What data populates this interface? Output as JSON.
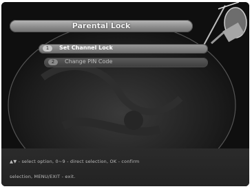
{
  "menu": {
    "title": "Parental Lock",
    "items": [
      {
        "number": "1",
        "label": "Set Channel Lock",
        "selected": true
      },
      {
        "number": "2",
        "label": "Change PIN Code",
        "selected": false
      }
    ]
  },
  "help": {
    "line1": "▲▼ - select option, 0~9 - direct selection, OK - confirm",
    "line2": "selection, MENU/EXIT - exit."
  },
  "colors": {
    "screen_bg": "#0f0f0f",
    "title_bar": "#9a9a9a",
    "selected_item": "#858585",
    "normal_item": "#4a4a4a",
    "help_bar": "#262626"
  },
  "icons": [
    "satellite-dish-icon",
    "earth-backdrop"
  ]
}
